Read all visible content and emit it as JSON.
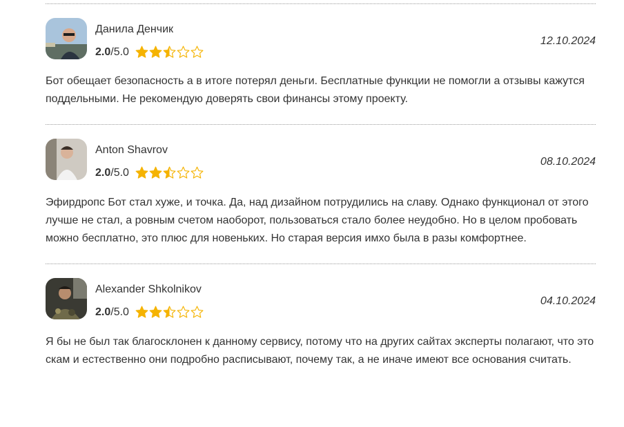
{
  "reviews": [
    {
      "author": "Данила Денчик",
      "score": "2.0",
      "max": "/5.0",
      "rating_value": 2.5,
      "date": "12.10.2024",
      "text": "Бот обещает безопасность а в итоге потерял деньги. Бесплатные функции не помогли а отзывы кажутся поддельными. Не рекомендую доверять свои финансы этому проекту."
    },
    {
      "author": "Anton Shavrov",
      "score": "2.0",
      "max": "/5.0",
      "rating_value": 2.5,
      "date": "08.10.2024",
      "text": "Эфирдропс Бот стал хуже, и точка. Да, над дизайном потрудились на славу. Однако функционал от этого лучше не стал, а ровным счетом наоборот, пользоваться стало более неудобно. Но в целом пробовать можно бесплатно, это плюс для новеньких. Но старая версия имхо была в разы комфортнее."
    },
    {
      "author": "Alexander Shkolnikov",
      "score": "2.0",
      "max": "/5.0",
      "rating_value": 2.5,
      "date": "04.10.2024",
      "text": "Я бы не был так благосклонен к данному сервису, потому что на других сайтах эксперты полагают, что это скам и естественно они подробно расписывают, почему так, а не иначе имеют все основания считать."
    }
  ],
  "colors": {
    "star": "#f5b301",
    "text": "#333333",
    "divider": "#9a9a9a"
  },
  "icons": {
    "star_full": "star-full-icon",
    "star_half": "star-half-icon",
    "star_empty": "star-empty-icon"
  }
}
